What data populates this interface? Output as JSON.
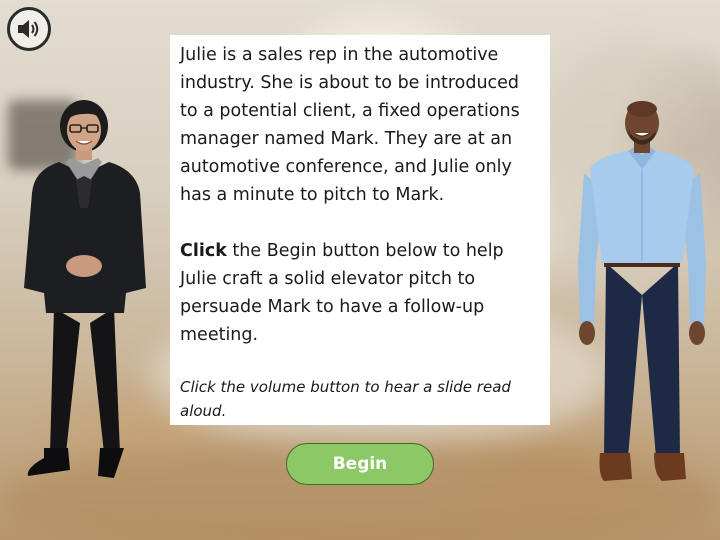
{
  "audio": {
    "icon": "speaker-volume-icon"
  },
  "intro": {
    "paragraph1": "Julie is a sales rep in the automotive industry. She is about to be introduced to a potential client, a fixed operations manager named Mark. They are at an automotive conference, and Julie only has a minute to pitch to Mark.",
    "click_word": "Click",
    "paragraph2_rest": " the Begin button below to help Julie craft a solid elevator pitch to persuade Mark to have a follow-up meeting.",
    "hint": "Click the volume button to hear a slide read aloud."
  },
  "begin_button": {
    "label": "Begin"
  },
  "colors": {
    "button_fill": "#8cc865",
    "button_border": "#3d6e1f",
    "panel": "#ffffff",
    "text": "#1a1a1a"
  }
}
